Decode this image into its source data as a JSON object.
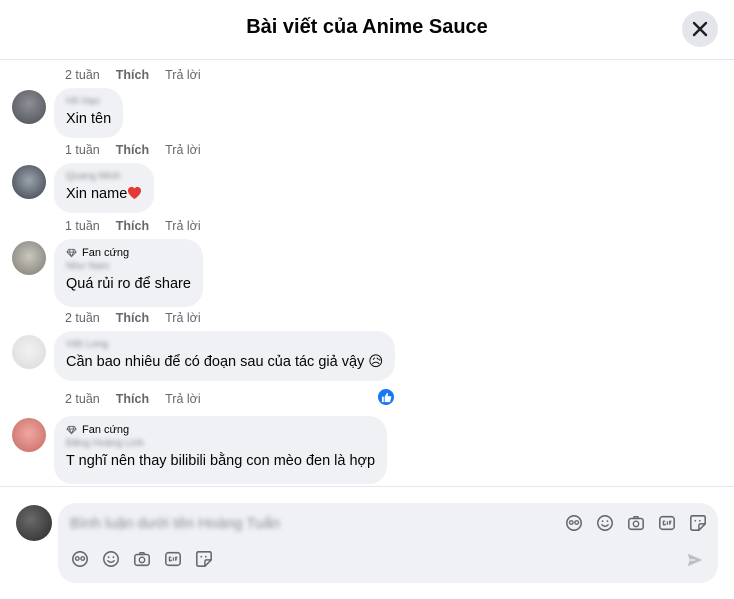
{
  "header": {
    "title": "Bài viết của Anime Sauce"
  },
  "comments": [
    {
      "meta": {
        "time": "2 tuần",
        "like": "Thích",
        "reply": "Trả lời"
      }
    },
    {
      "name": "Hồ Hạo",
      "text": "Xin tên",
      "meta": {
        "time": "1 tuần",
        "like": "Thích",
        "reply": "Trả lời"
      }
    },
    {
      "name": "Quang Minh",
      "text": "Xin name",
      "meta": {
        "time": "1 tuần",
        "like": "Thích",
        "reply": "Trả lời"
      }
    },
    {
      "badge": "Fan cứng",
      "name": "Như Nam",
      "text": "Quá rủi ro để share",
      "meta": {
        "time": "2 tuần",
        "like": "Thích",
        "reply": "Trả lời"
      }
    },
    {
      "name": "Việt Long",
      "text": "Cần bao nhiêu để có đoạn sau của tác giả vậy 😥",
      "meta": {
        "time": "2 tuần",
        "like": "Thích",
        "reply": "Trả lời"
      }
    },
    {
      "badge": "Fan cứng",
      "name": "Đăng Hoàng Linh",
      "text": "T nghĩ nên thay bilibili bằng con mèo đen là hợp"
    }
  ],
  "composer": {
    "placeholder": "Bình luận dưới tên Hoàng Tuấn"
  },
  "icons": {
    "close": "close-icon",
    "reaction": "like-icon",
    "badge": "diamond-icon",
    "composer": [
      "avatar-sticker-icon",
      "emoji-icon",
      "camera-icon",
      "gif-icon",
      "sticker-icon"
    ],
    "send": "send-icon"
  },
  "colors": {
    "accent": "#1877f2",
    "bubble": "#eff1f4",
    "muted": "#65676b"
  }
}
